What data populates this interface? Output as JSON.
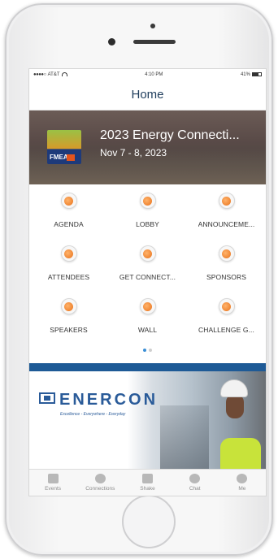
{
  "status_bar": {
    "carrier": "AT&T",
    "signal": "●●●●○",
    "time": "4:10 PM",
    "battery": "41%"
  },
  "navbar": {
    "title": "Home"
  },
  "banner": {
    "title": "2023 Energy Connecti...",
    "dates": "Nov 7 - 8, 2023",
    "logo_text": "FMEA"
  },
  "grid": {
    "items": [
      {
        "label": "AGENDA",
        "icon": "agenda-icon"
      },
      {
        "label": "LOBBY",
        "icon": "lobby-icon"
      },
      {
        "label": "ANNOUNCEME...",
        "icon": "announcements-icon"
      },
      {
        "label": "ATTENDEES",
        "icon": "attendees-icon"
      },
      {
        "label": "GET CONNECT...",
        "icon": "get-connected-icon"
      },
      {
        "label": "SPONSORS",
        "icon": "sponsors-icon"
      },
      {
        "label": "SPEAKERS",
        "icon": "speakers-icon"
      },
      {
        "label": "WALL",
        "icon": "wall-icon"
      },
      {
        "label": "CHALLENGE G...",
        "icon": "challenge-icon"
      }
    ],
    "page_count": 2,
    "active_page": 1
  },
  "ad": {
    "brand": "ENERCON",
    "tagline": "Excellence - Everywhere - Everyday"
  },
  "tabbar": {
    "items": [
      {
        "label": "Events",
        "icon": "calendar-icon"
      },
      {
        "label": "Connections",
        "icon": "people-icon"
      },
      {
        "label": "Shake",
        "icon": "shake-icon"
      },
      {
        "label": "Chat",
        "icon": "chat-icon"
      },
      {
        "label": "Me",
        "icon": "person-icon"
      }
    ]
  },
  "colors": {
    "nav_title": "#1f3d5c",
    "icon_accent": "#e8711a",
    "divider": "#1e5a96",
    "brand_blue": "#2a5b99",
    "pager_active": "#3b8fd6"
  }
}
